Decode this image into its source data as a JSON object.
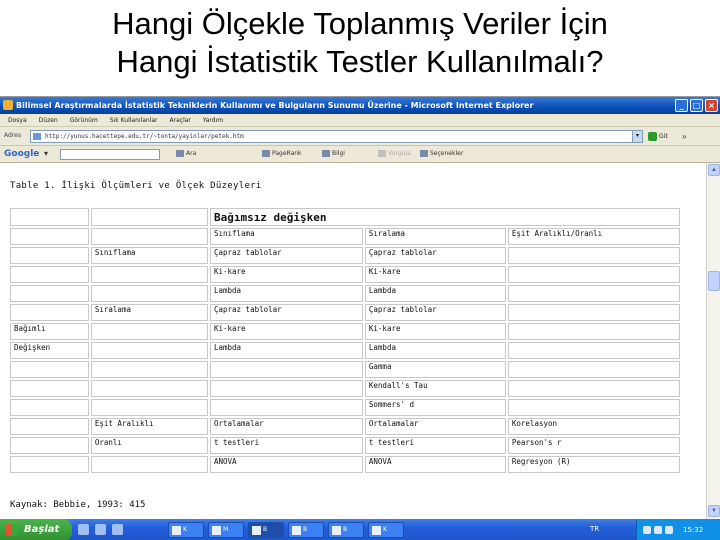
{
  "slide": {
    "title_line1": "Hangi Ölçekle Toplanmış Veriler İçin",
    "title_line2": "Hangi İstatistik Testler Kullanılmalı?"
  },
  "window": {
    "title": "Bilimsel Araştırmalarda İstatistik Tekniklerin Kullanımı ve Bulguların Sunumu Üzerine - Microsoft Internet Explorer",
    "minimize": "_",
    "maximize": "□",
    "close": "×"
  },
  "menu": [
    "Dosya",
    "Düzen",
    "Görünüm",
    "Sık Kullanılanlar",
    "Araçlar",
    "Yardım"
  ],
  "address": {
    "label": "Adres",
    "url": "http://yunus.hacettepe.edu.tr/~tonta/yayinlar/petek.htm",
    "go_label": "Git",
    "links_label": "»"
  },
  "google_toolbar": {
    "logo": "Google",
    "dropdown": "▾",
    "tools": [
      {
        "label": "Ara",
        "disabled": false
      },
      {
        "label": "PageRank",
        "disabled": false
      },
      {
        "label": "Bilgi",
        "disabled": false
      },
      {
        "label": "Vurgula",
        "disabled": true
      },
      {
        "label": "Seçenekler",
        "disabled": false
      }
    ]
  },
  "document": {
    "caption": "Table 1. İlişki Ölçümleri ve Ölçek Düzeyleri",
    "source": "Kaynak: Bebbie, 1993: 415",
    "rows": [
      [
        "",
        "",
        "Bağımsız değişken",
        "",
        ""
      ],
      [
        "",
        "",
        "Sınıflama",
        "Sıralama",
        "Eşit Aralıklı/Oranlı"
      ],
      [
        "",
        "Sınıflama",
        "Çapraz tablolar",
        "Çapraz tablolar",
        ""
      ],
      [
        "",
        "",
        "Ki-kare",
        "Ki-kare",
        ""
      ],
      [
        "",
        "",
        "Lambda",
        "Lambda",
        ""
      ],
      [
        "",
        "Sıralama",
        "Çapraz tablolar",
        "Çapraz tablolar",
        ""
      ],
      [
        "Bağımlı",
        "",
        "Ki-kare",
        "Ki-kare",
        ""
      ],
      [
        "Değişken",
        "",
        "Lambda",
        "Lambda",
        ""
      ],
      [
        "",
        "",
        "",
        "Gamma",
        ""
      ],
      [
        "",
        "",
        "",
        "Kendall's Tau",
        ""
      ],
      [
        "",
        "",
        "",
        "Sommers' d",
        ""
      ],
      [
        "",
        "Eşit Aralıklı",
        "Ortalamalar",
        "Ortalamalar",
        "Korelasyon"
      ],
      [
        "",
        "Oranlı",
        "t testleri",
        "t testleri",
        "Pearson's r"
      ],
      [
        "",
        "",
        "ANOVA",
        "ANOVA",
        "Regresyon (R)"
      ]
    ]
  },
  "taskbar": {
    "start_label": "Başlat",
    "tasks": [
      "K",
      "M",
      "B",
      "B",
      "B",
      "K"
    ],
    "language": "TR",
    "clock": "15:32"
  }
}
